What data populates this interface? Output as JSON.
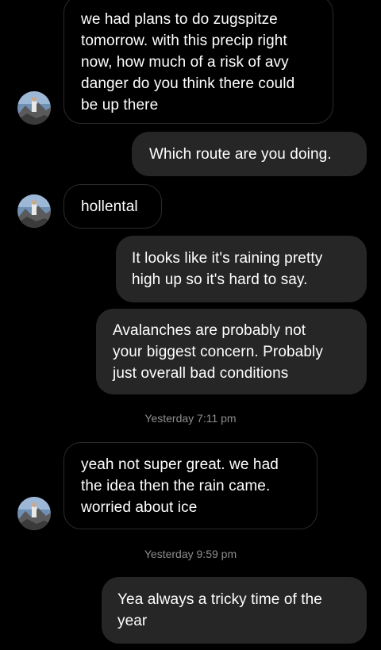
{
  "thread": {
    "messages": [
      {
        "direction": "incoming",
        "lines": [
          "we had plans to do zugspitze",
          "tomorrow. with this precip right",
          "now, how much of a risk of avy",
          "danger do you think there could",
          "be up there"
        ]
      },
      {
        "direction": "outgoing",
        "lines": [
          "Which route are you doing."
        ]
      },
      {
        "direction": "incoming",
        "lines": [
          "hollental"
        ]
      },
      {
        "direction": "outgoing",
        "lines": [
          "It looks like it's raining pretty",
          "high up so it's hard to say."
        ]
      },
      {
        "direction": "outgoing",
        "lines": [
          "Avalanches are probably not",
          "your biggest concern. Probably",
          "just overall bad conditions"
        ]
      },
      {
        "direction": "incoming",
        "lines": [
          "yeah not super great. we had",
          "the idea then the rain came.",
          "worried about ice"
        ]
      },
      {
        "direction": "outgoing",
        "lines": [
          "Yea always a tricky time of the",
          "year"
        ]
      }
    ],
    "timestamps": [
      "Yesterday 7:11 pm",
      "Yesterday 9:59 pm"
    ]
  },
  "colors": {
    "background": "#000000",
    "outgoing_bubble": "#262626",
    "incoming_border": "#2b2b2b",
    "text": "#ffffff",
    "timestamp": "#8e8e8e"
  },
  "icons": {
    "avatar": "contact-avatar-mountain-photo"
  }
}
